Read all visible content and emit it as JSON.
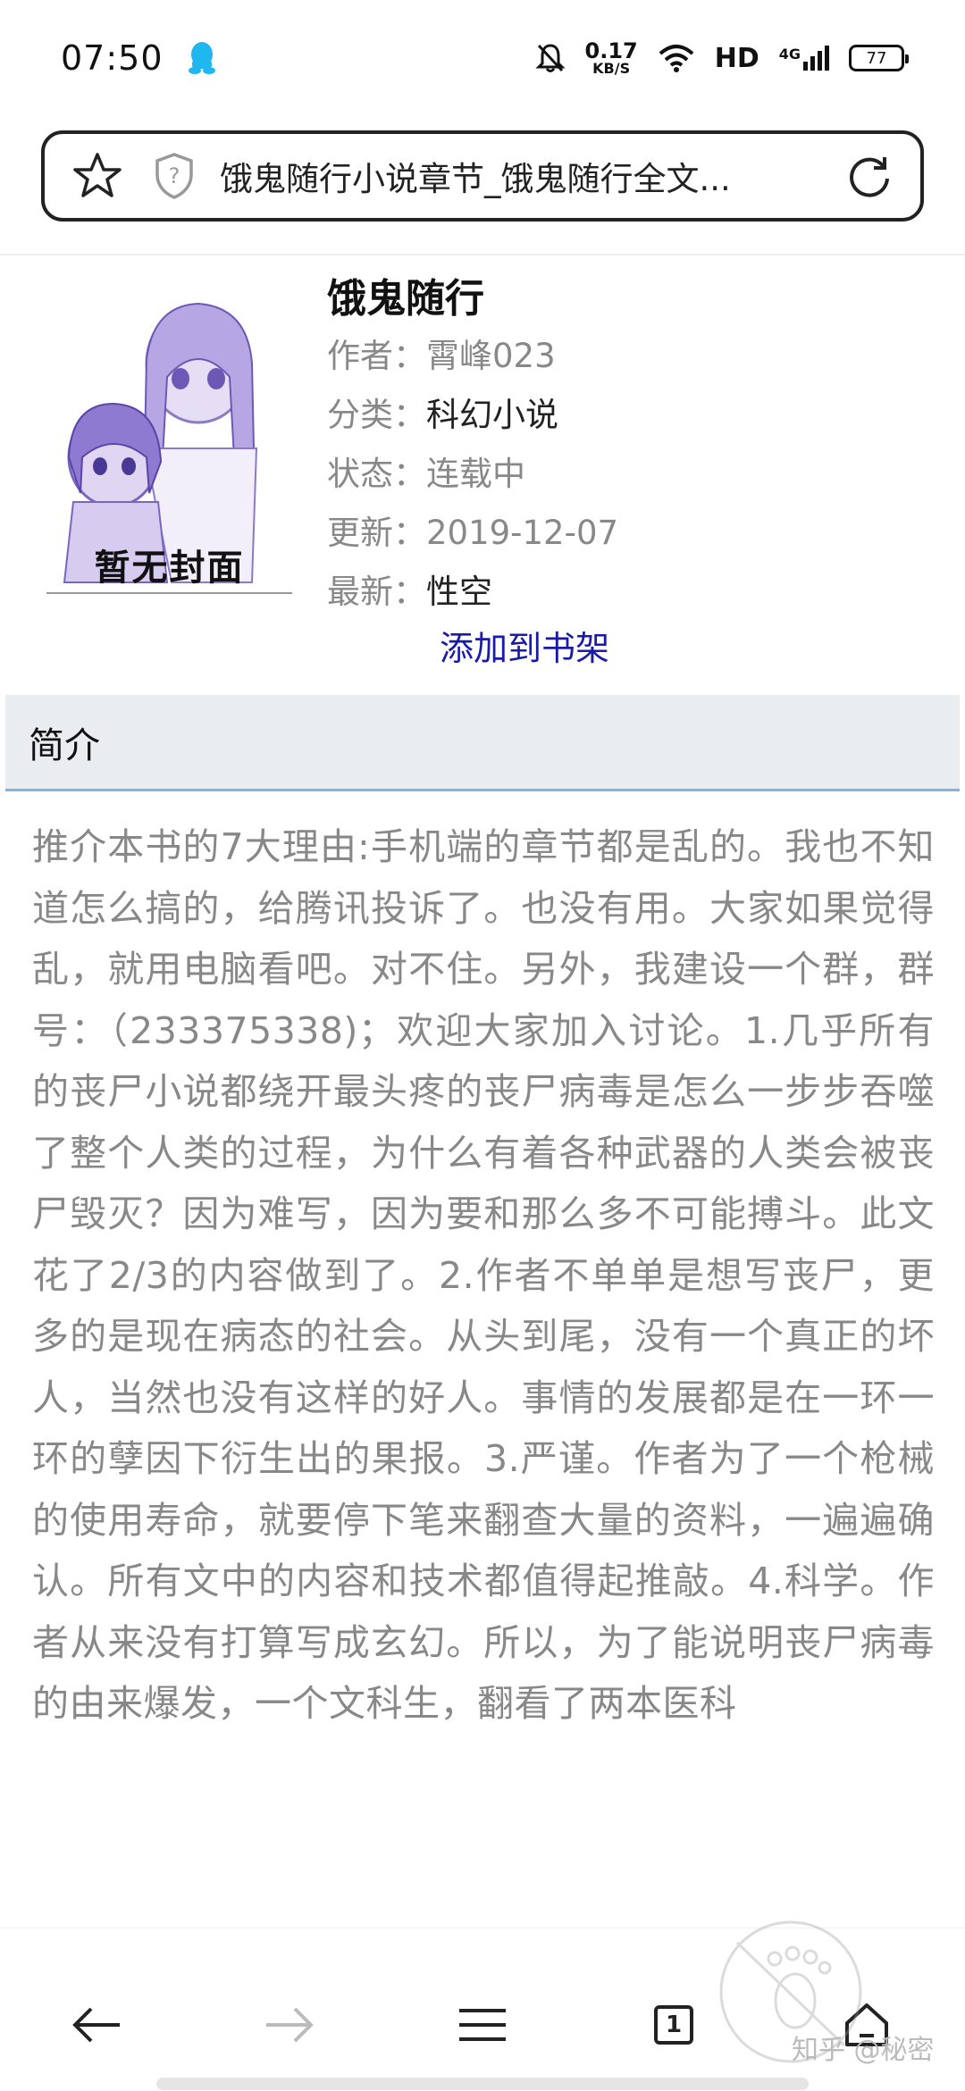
{
  "status_bar": {
    "time": "07:50",
    "net_speed_value": "0.17",
    "net_speed_unit": "KB/S",
    "network_label": "HD",
    "network_gen": "4G",
    "battery": "77"
  },
  "url_bar": {
    "page_title": "饿鬼随行小说章节_饿鬼随行全文..."
  },
  "book": {
    "title": "饿鬼随行",
    "cover_caption": "暂无封面",
    "author_label": "作者：",
    "author": "霄峰023",
    "category_label": "分类：",
    "category": "科幻小说",
    "status_label": "状态：",
    "status": "连载中",
    "updated_label": "更新：",
    "updated": "2019-12-07",
    "latest_label": "最新：",
    "latest": "性空",
    "add_to_shelf": "添加到书架"
  },
  "intro": {
    "header": "简介",
    "text": "推介本书的7大理由:手机端的章节都是乱的。我也不知道怎么搞的，给腾讯投诉了。也没有用。大家如果觉得乱，就用电脑看吧。对不住。另外，我建设一个群，群号：（233375338)；欢迎大家加入讨论。1.几乎所有的丧尸小说都绕开最头疼的丧尸病毒是怎么一步步吞噬了整个人类的过程，为什么有着各种武器的人类会被丧尸毁灭？因为难写，因为要和那么多不可能搏斗。此文花了2/3的内容做到了。2.作者不单单是想写丧尸，更多的是现在病态的社会。从头到尾，没有一个真正的坏人，当然也没有这样的好人。事情的发展都是在一环一环的孽因下衍生出的果报。3.严谨。作者为了一个枪械的使用寿命，就要停下笔来翻查大量的资料，一遍遍确认。所有文中的内容和技术都值得起推敲。4.科学。作者从来没有打算写成玄幻。所以，为了能说明丧尸病毒的由来爆发，一个文科生，翻看了两本医科"
  },
  "watermark": {
    "text": "知乎 @秘密"
  },
  "bottom_nav": {
    "tab_count": "1"
  }
}
